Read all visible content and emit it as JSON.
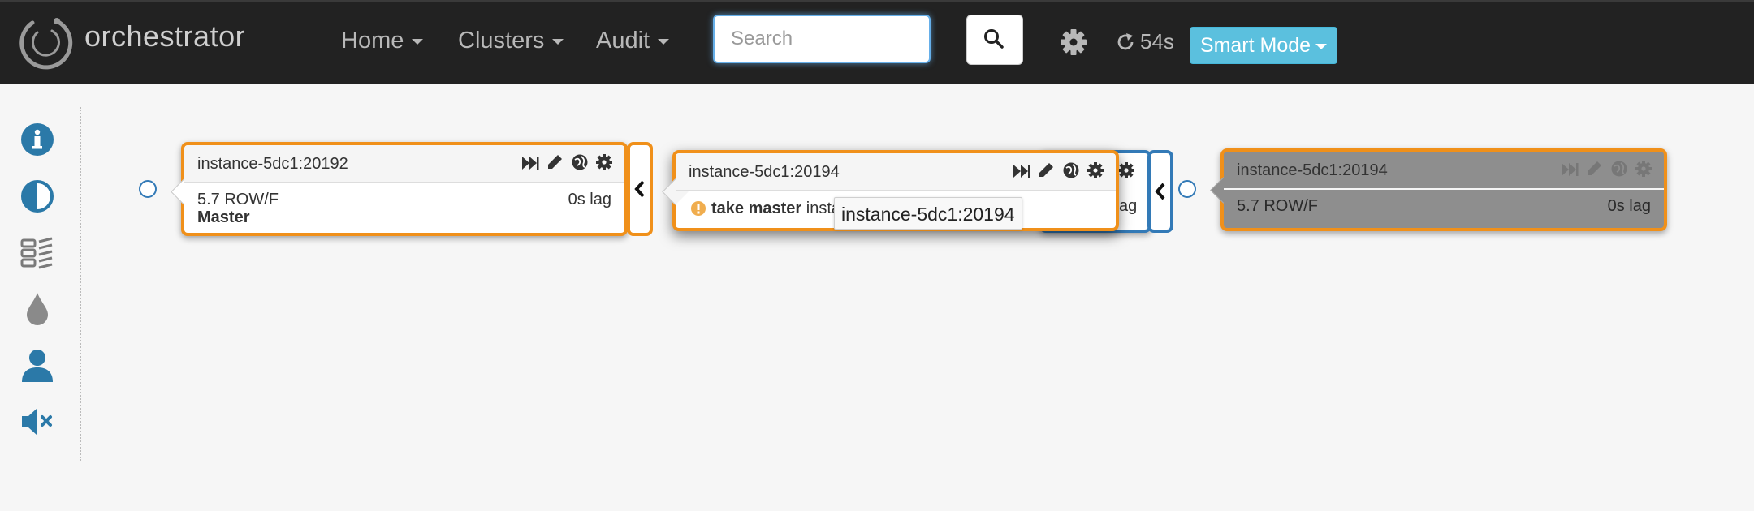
{
  "app": {
    "title": "orchestrator"
  },
  "nav": {
    "home": "Home",
    "clusters": "Clusters",
    "audit": "Audit",
    "search_placeholder": "Search",
    "refresh": "54s",
    "smart_mode": "Smart Mode"
  },
  "sidebar": {
    "items": [
      "info-icon",
      "contrast-icon",
      "database-icon",
      "drop-icon",
      "user-icon",
      "mute-icon"
    ],
    "accent": "#2b79a8"
  },
  "nodes": {
    "master": {
      "title": "instance-5dc1:20192",
      "version": "5.7 ROW/F",
      "lag": "0s lag",
      "role": "Master"
    },
    "dragged": {
      "title": "instance-5dc1:20194",
      "warning_bold": "take master",
      "warning_rest": "insta"
    },
    "behind_lag": "ag",
    "replica": {
      "title": "instance-5dc1:20194",
      "version": "5.7 ROW/F",
      "lag": "0s lag"
    }
  },
  "tooltip": "instance-5dc1:20194",
  "colors": {
    "orange": "#f0901a",
    "blue": "#337ab7",
    "navbar": "#222222",
    "smart_mode": "#5bc0de"
  }
}
